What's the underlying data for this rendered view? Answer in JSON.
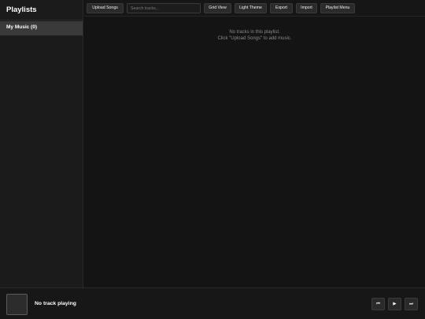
{
  "sidebar": {
    "title": "Playlists",
    "playlists": [
      {
        "label": "My Music (0)",
        "active": true
      }
    ]
  },
  "toolbar": {
    "upload_label": "Upload Songs",
    "search_placeholder": "Search tracks...",
    "search_value": "",
    "grid_view_label": "Grid View",
    "theme_label": "Light Theme",
    "export_label": "Export",
    "import_label": "Import",
    "playlist_menu_label": "Playlist Menu"
  },
  "main": {
    "empty_line1": "No tracks in this playlist.",
    "empty_line2": "Click \"Upload Songs\" to add music."
  },
  "player": {
    "now_playing": "No track playing",
    "prev_icon": "⏮",
    "play_icon": "▶",
    "next_icon": "⏭"
  },
  "colors": {
    "background": "#121212",
    "sidebar": "#1b1b1b",
    "active_item": "#3a3a3a",
    "button": "#2b2b2b",
    "muted_text": "#8a8a8a"
  }
}
